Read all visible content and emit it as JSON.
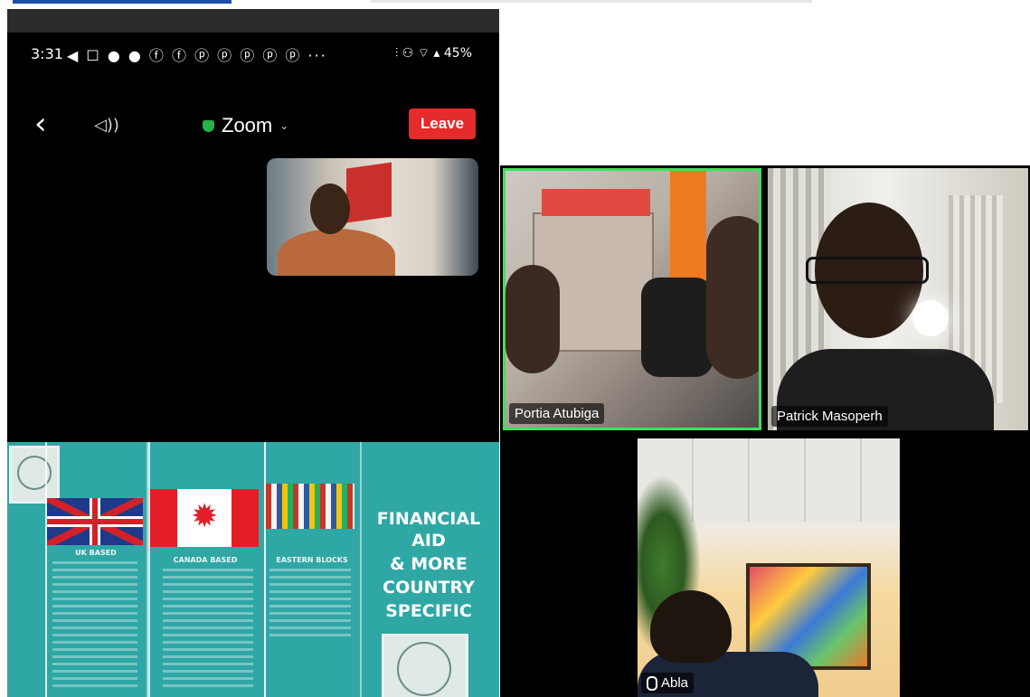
{
  "phone": {
    "status": {
      "time": "3:31",
      "notifications": "◀ ☐ ● ● ⓕ ⓕ ⓟ ⓟ ⓟ ⓟ ⓟ ···",
      "right_icons": "⫶ ⚇ ⌔ ▴ 45%",
      "battery": "45%"
    },
    "meeting": {
      "title": "Zoom",
      "leave_label": "Leave"
    },
    "slide": {
      "uk_heading": "UK BASED",
      "canada_heading": "CANADA BASED",
      "eastern_heading": "EASTERN BLOCKS",
      "main_heading_1": "FINANCIAL",
      "main_heading_2": "AID",
      "main_heading_3": "& MORE",
      "main_heading_4": "COUNTRY",
      "main_heading_5": "SPECIFIC"
    }
  },
  "participants": [
    {
      "name": "Portia Atubiga",
      "active_speaker": true
    },
    {
      "name": "Patrick Masoperh",
      "active_speaker": false
    },
    {
      "name": "Abla",
      "active_speaker": false,
      "muted": true
    }
  ],
  "colors": {
    "leave": "#e52b2b",
    "active_border": "#3ee05b",
    "slide_bg": "#2fa7a5",
    "secure_shield": "#27b14a"
  }
}
